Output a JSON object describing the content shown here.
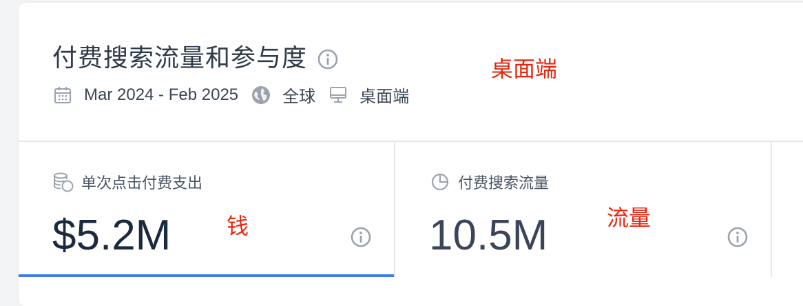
{
  "header": {
    "title": "付费搜索流量和参与度",
    "date_range": "Mar 2024 - Feb 2025",
    "region": "全球",
    "device": "桌面端"
  },
  "annotations": {
    "device_note": "桌面端",
    "money_note": "钱",
    "traffic_note": "流量",
    "color": "#e8250f"
  },
  "metrics": [
    {
      "label": "单次点击付费支出",
      "value": "$5.2M",
      "icon": "coins-icon",
      "active": true
    },
    {
      "label": "付费搜索流量",
      "value": "10.5M",
      "icon": "pie-chart-icon",
      "active": false
    }
  ],
  "colors": {
    "accent": "#3f7ee8",
    "text_primary": "#1c2a3d",
    "icon_gray": "#9aa3ad"
  }
}
